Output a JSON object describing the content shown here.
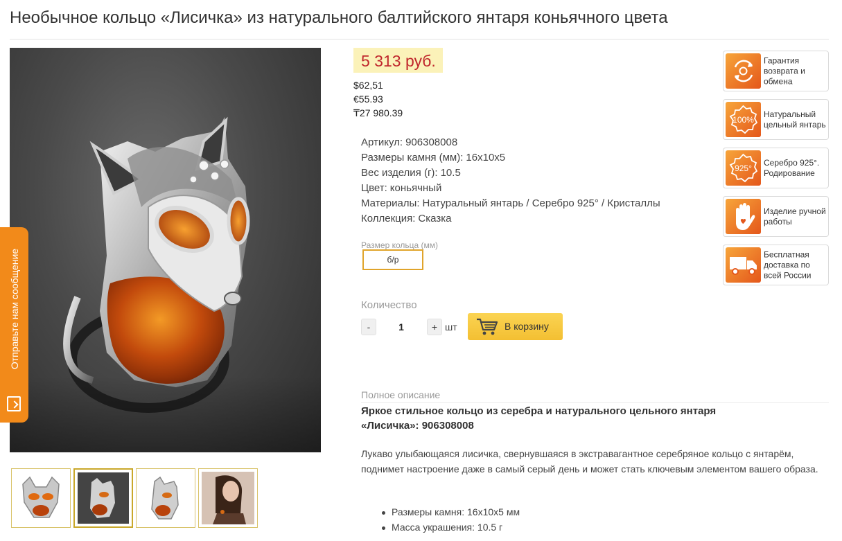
{
  "product": {
    "title": "Необычное кольцо «Лисичка» из натурального балтийского янтаря коньячного цвета",
    "image_alt": "Кольцо Лисичка"
  },
  "price": {
    "main": "5 313 руб.",
    "usd": "$62,51",
    "eur": "€55.93",
    "kzt": "₸27 980.39"
  },
  "specs": [
    {
      "key": "Артикул:",
      "value": "906308008"
    },
    {
      "key": "Размеры камня (мм):",
      "value": "16x10x5"
    },
    {
      "key": "Вес изделия (г):",
      "value": "10.5"
    },
    {
      "key": "Цвет:",
      "value": "коньячный"
    },
    {
      "key": "Материалы:",
      "value": "Натуральный янтарь / Серебро 925° / Кристаллы"
    },
    {
      "key": "Коллекция:",
      "value": "Сказка"
    }
  ],
  "size": {
    "label": "Размер кольца (мм)",
    "selected": "б/р"
  },
  "quantity": {
    "label": "Количество",
    "minus": "-",
    "value": "1",
    "plus": "+",
    "unit": "шт"
  },
  "cart": {
    "button_label": "В корзину",
    "icon": "cart-icon"
  },
  "description": {
    "label": "Полное описание",
    "title": "Яркое стильное кольцо из серебра и натурального цельного янтаря «Лисичка»: 906308008",
    "text": "Лукаво улыбающаяся лисичка, свернувшаяся в экстравагантное серебряное кольцо с янтарём, поднимет настроение даже в самый серый день и может стать ключевым элементом вашего образа.",
    "bullets": [
      "Размеры камня: 16x10x5 мм",
      "Масса украшения: 10.5 г"
    ]
  },
  "badges": [
    {
      "label": "Гарантия возврата и обмена",
      "icon": "return-icon"
    },
    {
      "label": "Натуральный цельный янтарь",
      "icon": "100-percent-icon"
    },
    {
      "label": "Серебро 925°. Родирование",
      "icon": "silver-925-icon"
    },
    {
      "label": "Изделие ручной работы",
      "icon": "hand-icon"
    },
    {
      "label": "Бесплатная доставка по всей России",
      "icon": "truck-icon"
    }
  ],
  "feedback": {
    "label": "Отправьте нам сообщение"
  },
  "colors": {
    "price_red": "#c0262c",
    "price_bg": "#fbf2b9",
    "accent_orange": "#f28a1a",
    "cart_yellow": "#f3bf32",
    "size_border": "#e0a42b"
  }
}
